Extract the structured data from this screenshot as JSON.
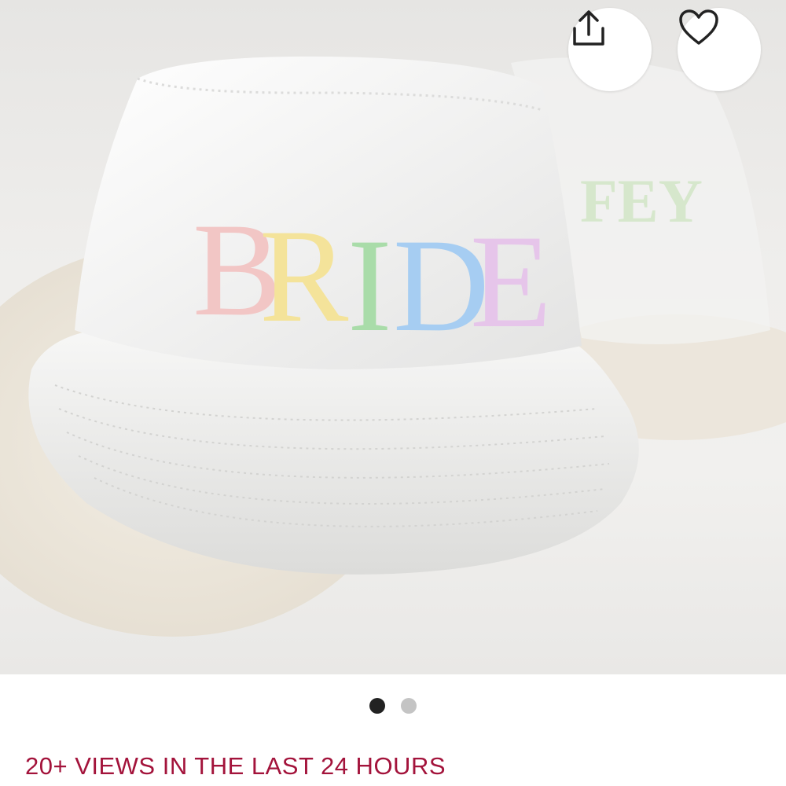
{
  "product_image": {
    "front_hat_text": "BRIDE",
    "back_hat_text": "FEY",
    "letter_colors": [
      "#f2c6c5",
      "#f4e39a",
      "#a9dca9",
      "#a6cdf2",
      "#e6c5ea"
    ]
  },
  "actions": {
    "share_icon": "share-icon",
    "favorite_icon": "heart-icon"
  },
  "carousel": {
    "total": 2,
    "active_index": 0
  },
  "social_proof": {
    "views_text": "20+ VIEWS IN THE LAST 24 HOURS",
    "color": "#a3133b"
  }
}
